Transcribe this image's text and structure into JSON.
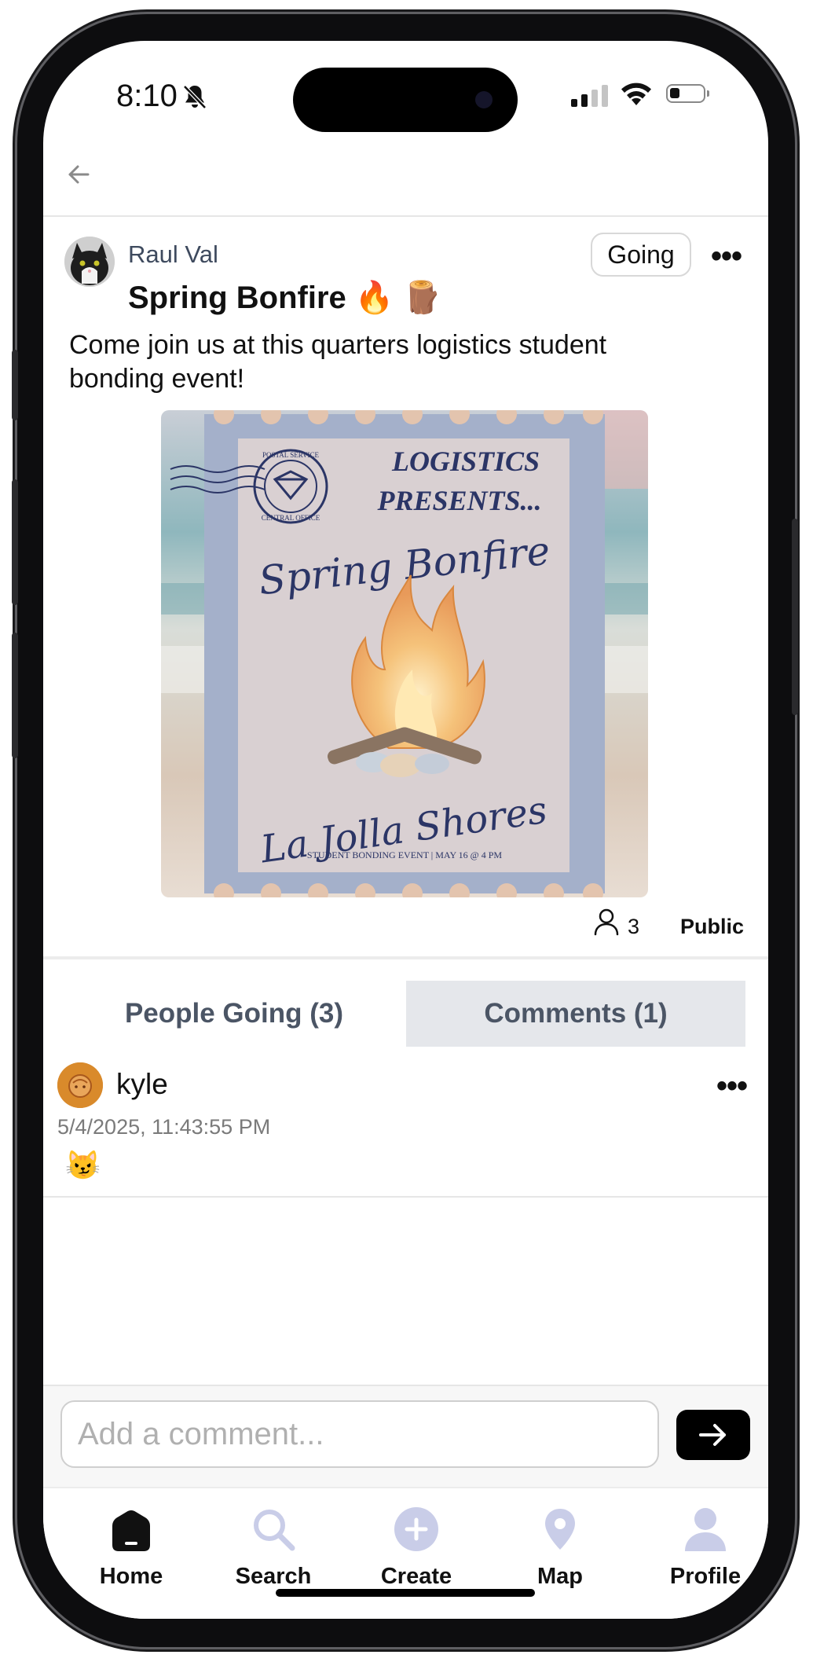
{
  "status_bar": {
    "time": "8:10"
  },
  "event": {
    "author": "Raul Val",
    "going_label": "Going",
    "title": "Spring Bonfire 🔥 🪵",
    "description": "Come join us at this quarters logistics student bonding event!",
    "attendees_count": "3",
    "visibility": "Public"
  },
  "poster": {
    "stamp_line1": "POSTAL SERVICE",
    "stamp_line2": "CENTRAL OFFICE",
    "heading_line1": "LOGISTICS",
    "heading_line2": "PRESENTS...",
    "script_title": "Spring Bonfire",
    "location": "La Jolla Shores",
    "footer": "STUDENT BONDING EVENT | MAY 16 @ 4 PM"
  },
  "tabs": {
    "going": "People Going (3)",
    "comments": "Comments (1)",
    "active": "comments"
  },
  "comments": [
    {
      "user": "kyle",
      "timestamp": "5/4/2025, 11:43:55 PM",
      "body": "😼"
    }
  ],
  "comment_input": {
    "placeholder": "Add a comment..."
  },
  "nav": [
    {
      "label": "Home",
      "icon": "home-icon"
    },
    {
      "label": "Search",
      "icon": "search-icon"
    },
    {
      "label": "Create",
      "icon": "plus-circle-icon"
    },
    {
      "label": "Map",
      "icon": "map-pin-icon"
    },
    {
      "label": "Profile",
      "icon": "profile-icon"
    }
  ],
  "colors": {
    "active_tab_bg": "#e5e7eb",
    "nav_inactive": "#c9cde8",
    "author_text": "#3e4a5e"
  }
}
